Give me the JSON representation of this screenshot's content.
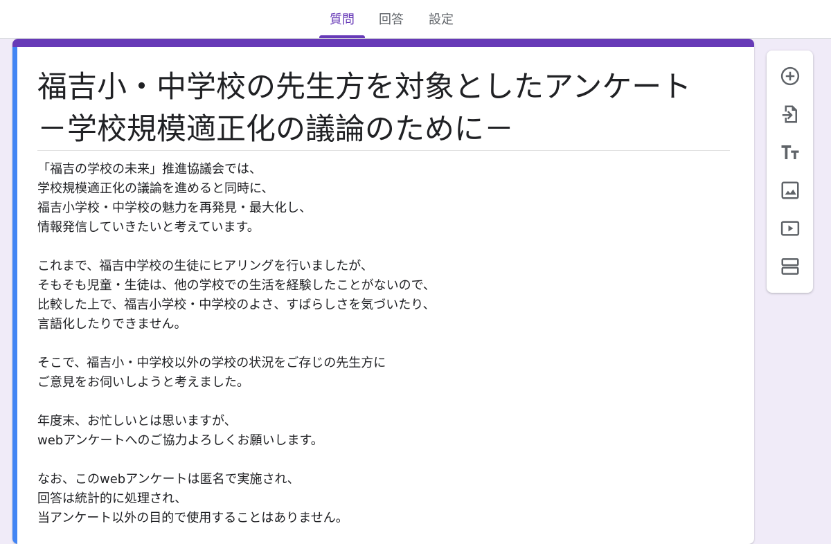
{
  "tabs": [
    {
      "label": "質問",
      "active": true
    },
    {
      "label": "回答",
      "active": false
    },
    {
      "label": "設定",
      "active": false
    }
  ],
  "form": {
    "title": "福吉小・中学校の先生方を対象としたアンケート\n－学校規模適正化の議論のために－",
    "description": "「福吉の学校の未来」推進協議会では、\n学校規模適正化の議論を進めると同時に、\n福吉小学校・中学校の魅力を再発見・最大化し、\n情報発信していきたいと考えています。\n\nこれまで、福吉中学校の生徒にヒアリングを行いましたが、\nそもそも児童・生徒は、他の学校での生活を経験したことがないので、\n比較した上で、福吉小学校・中学校のよさ、すばらしさを気づいたり、\n言語化したりできません。\n\nそこで、福吉小・中学校以外の学校の状況をご存じの先生方に\nご意見をお伺いしようと考えました。\n\n年度末、お忙しいとは思いますが、\nwebアンケートへのご協力よろしくお願いします。\n\nなお、このwebアンケートは匿名で実施され、\n回答は統計的に処理され、\n当アンケート以外の目的で使用することはありません。"
  },
  "toolbar": [
    {
      "icon": "add-question-icon"
    },
    {
      "icon": "import-questions-icon"
    },
    {
      "icon": "add-title-icon"
    },
    {
      "icon": "add-image-icon"
    },
    {
      "icon": "add-video-icon"
    },
    {
      "icon": "add-section-icon"
    }
  ],
  "colors": {
    "theme": "#673ab7",
    "active_card_bar": "#4285f4",
    "background": "#f0ebf8",
    "icon": "#5f6368"
  }
}
